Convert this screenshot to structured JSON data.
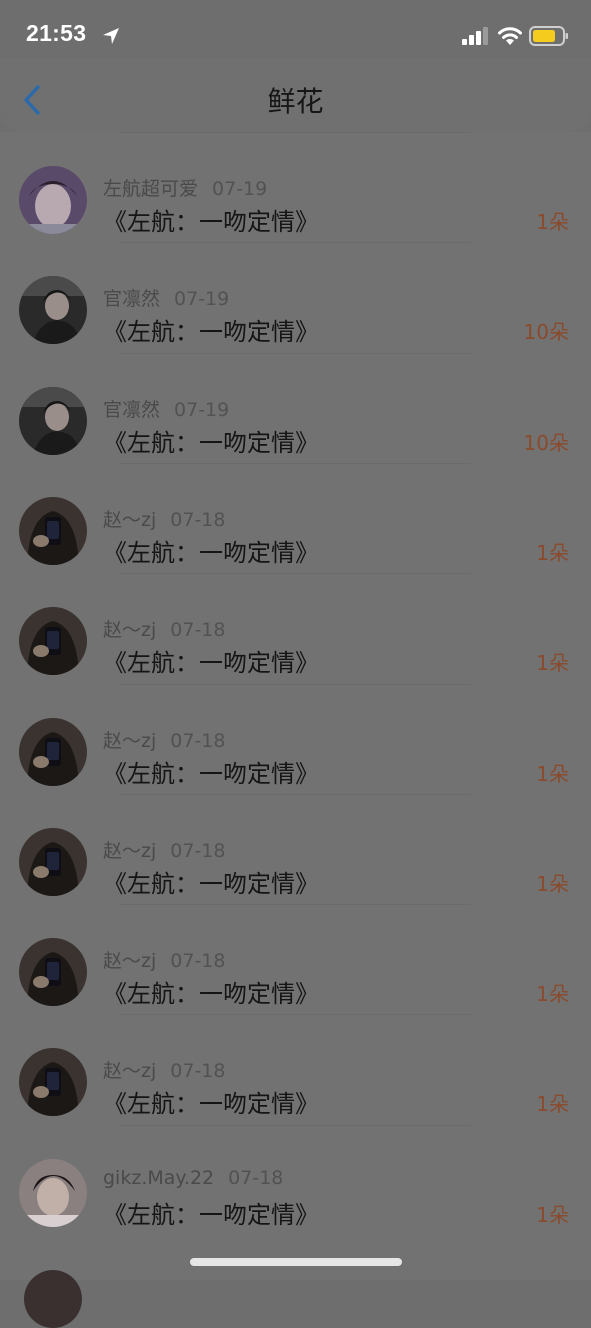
{
  "status_bar": {
    "time": "21:53",
    "icons": [
      "location-arrow-icon",
      "cellular-signal-icon",
      "wifi-icon",
      "battery-icon"
    ],
    "battery_color": "#f5cc1d"
  },
  "nav": {
    "back_icon": "chevron-left-icon",
    "title": "鲜花",
    "accent": "#2a6aaa"
  },
  "colors": {
    "flower_count": "#8a4a2c"
  },
  "rows": [
    {
      "user": "左航超可爱",
      "date": "07-19",
      "book": "《左航：一吻定情》",
      "count": "1朵",
      "avatar": "avatar-purple"
    },
    {
      "user": "官凛然",
      "date": "07-19",
      "book": "《左航：一吻定情》",
      "count": "10朵",
      "avatar": "avatar-dark-stage"
    },
    {
      "user": "官凛然",
      "date": "07-19",
      "book": "《左航：一吻定情》",
      "count": "10朵",
      "avatar": "avatar-dark-stage"
    },
    {
      "user": "赵～zj",
      "date": "07-18",
      "book": "《左航：一吻定情》",
      "count": "1朵",
      "avatar": "avatar-phone-selfie"
    },
    {
      "user": "赵～zj",
      "date": "07-18",
      "book": "《左航：一吻定情》",
      "count": "1朵",
      "avatar": "avatar-phone-selfie"
    },
    {
      "user": "赵～zj",
      "date": "07-18",
      "book": "《左航：一吻定情》",
      "count": "1朵",
      "avatar": "avatar-phone-selfie"
    },
    {
      "user": "赵～zj",
      "date": "07-18",
      "book": "《左航：一吻定情》",
      "count": "1朵",
      "avatar": "avatar-phone-selfie"
    },
    {
      "user": "赵～zj",
      "date": "07-18",
      "book": "《左航：一吻定情》",
      "count": "1朵",
      "avatar": "avatar-phone-selfie"
    },
    {
      "user": "赵～zj",
      "date": "07-18",
      "book": "《左航：一吻定情》",
      "count": "1朵",
      "avatar": "avatar-phone-selfie"
    },
    {
      "user": "gikz.May.22",
      "date": "07-18",
      "book": "《左航：一吻定情》",
      "count": "1朵",
      "avatar": "avatar-light"
    }
  ]
}
